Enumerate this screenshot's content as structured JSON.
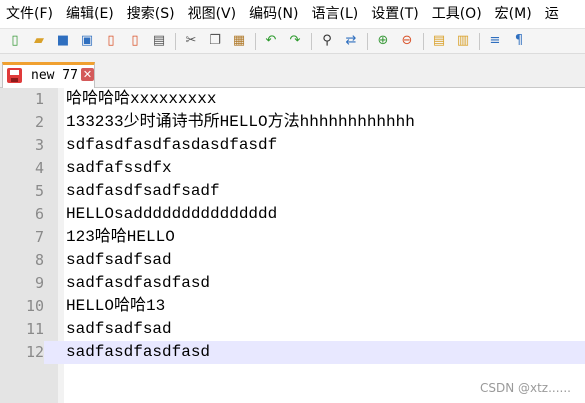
{
  "menu": [
    {
      "label": "文件(F)"
    },
    {
      "label": "编辑(E)"
    },
    {
      "label": "搜索(S)"
    },
    {
      "label": "视图(V)"
    },
    {
      "label": "编码(N)"
    },
    {
      "label": "语言(L)"
    },
    {
      "label": "设置(T)"
    },
    {
      "label": "工具(O)"
    },
    {
      "label": "宏(M)"
    },
    {
      "label": "运"
    }
  ],
  "toolbar": {
    "icons": [
      {
        "name": "new-file-icon",
        "glyph": "▯",
        "color": "#3a9a3a"
      },
      {
        "name": "open-file-icon",
        "glyph": "▰",
        "color": "#d9a12a"
      },
      {
        "name": "save-icon",
        "glyph": "■",
        "color": "#2f6fbf"
      },
      {
        "name": "save-all-icon",
        "glyph": "▣",
        "color": "#2f6fbf"
      },
      {
        "name": "close-icon",
        "glyph": "▯",
        "color": "#d9532a"
      },
      {
        "name": "close-all-icon",
        "glyph": "▯",
        "color": "#d9532a"
      },
      {
        "name": "print-icon",
        "glyph": "▤",
        "color": "#555555"
      },
      {
        "name": "cut-icon",
        "glyph": "✂",
        "color": "#555555"
      },
      {
        "name": "copy-icon",
        "glyph": "❐",
        "color": "#555555"
      },
      {
        "name": "paste-icon",
        "glyph": "▦",
        "color": "#b07a2a"
      },
      {
        "name": "undo-icon",
        "glyph": "↶",
        "color": "#2d9a2d"
      },
      {
        "name": "redo-icon",
        "glyph": "↷",
        "color": "#2d9a2d"
      },
      {
        "name": "find-icon",
        "glyph": "⚲",
        "color": "#333333"
      },
      {
        "name": "replace-icon",
        "glyph": "⇄",
        "color": "#2f6fbf"
      },
      {
        "name": "zoom-in-icon",
        "glyph": "⊕",
        "color": "#3a9a3a"
      },
      {
        "name": "zoom-out-icon",
        "glyph": "⊖",
        "color": "#d9532a"
      },
      {
        "name": "sync-vertical-icon",
        "glyph": "▤",
        "color": "#d9a12a"
      },
      {
        "name": "sync-horizontal-icon",
        "glyph": "▥",
        "color": "#d9a12a"
      },
      {
        "name": "word-wrap-icon",
        "glyph": "≡",
        "color": "#2f6fbf"
      },
      {
        "name": "show-all-chars-icon",
        "glyph": "¶",
        "color": "#2f6fbf"
      }
    ]
  },
  "tab": {
    "label": "new 77",
    "close_glyph": "✕",
    "save_icon_color": "#e03a3a",
    "accent_color": "#f0a030"
  },
  "editor": {
    "current_line": 12,
    "lines": [
      {
        "num": "1",
        "text": "哈哈哈哈xxxxxxxxx"
      },
      {
        "num": "2",
        "text": "133233少时诵诗书所HELLO方法hhhhhhhhhhhh"
      },
      {
        "num": "3",
        "text": "sdfasdfasdfasdasdfasdf"
      },
      {
        "num": "4",
        "text": "sadfafssdfx"
      },
      {
        "num": "5",
        "text": "sadfasdfsadfsadf"
      },
      {
        "num": "6",
        "text": "HELLOsaddddddddddddddd"
      },
      {
        "num": "7",
        "text": "123哈哈HELLO"
      },
      {
        "num": "8",
        "text": "sadfsadfsad"
      },
      {
        "num": "9",
        "text": "sadfasdfasdfasd"
      },
      {
        "num": "10",
        "text": "HELLO哈哈13"
      },
      {
        "num": "11",
        "text": "sadfsadfsad"
      },
      {
        "num": "12",
        "text": "sadfasdfasdfasd"
      }
    ]
  },
  "watermark": "CSDN @xtz......"
}
